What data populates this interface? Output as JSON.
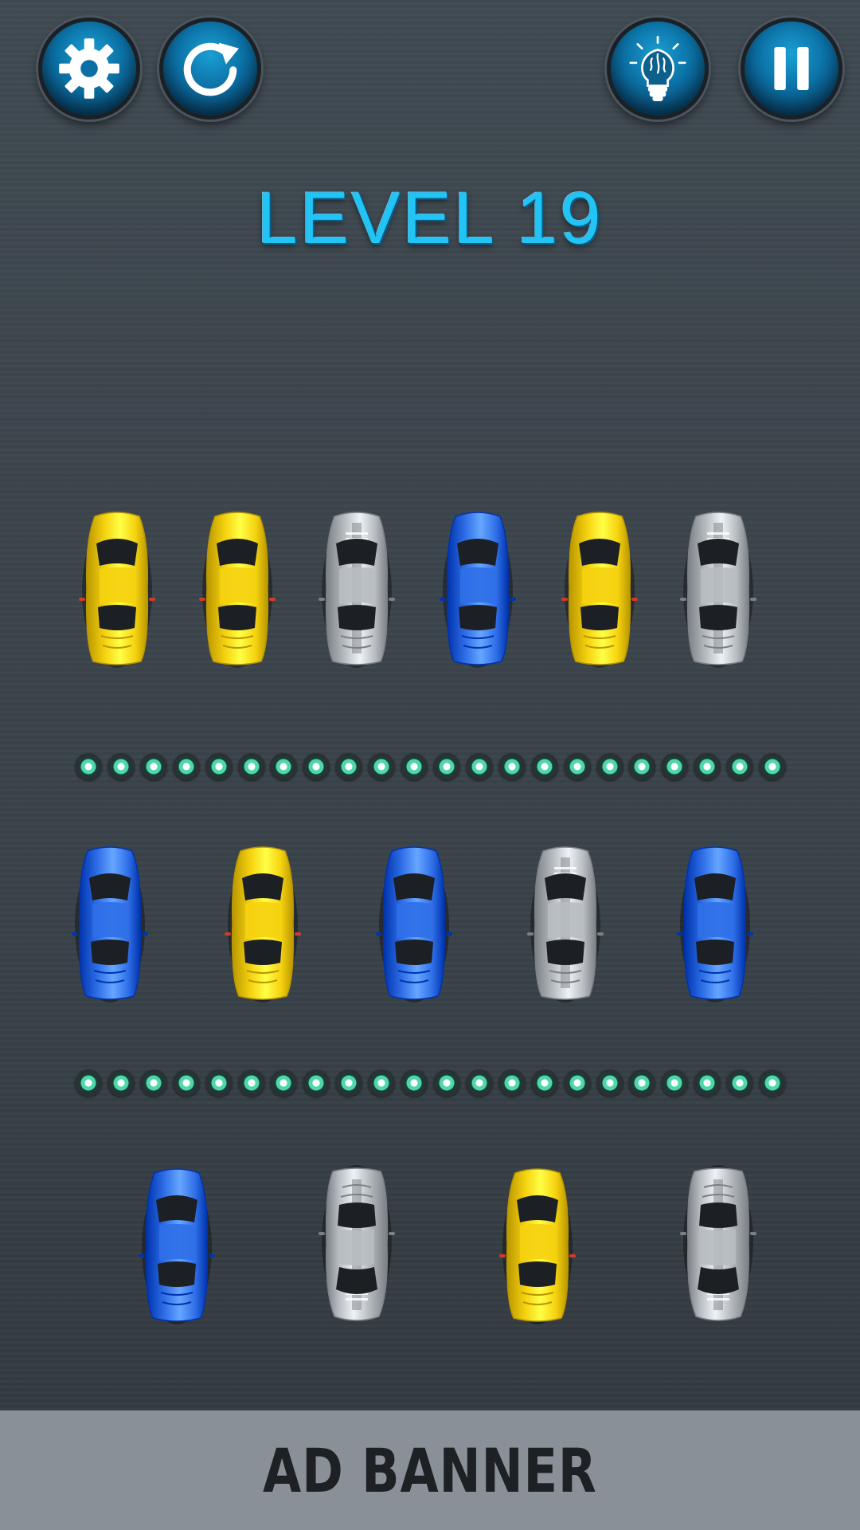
{
  "level": {
    "title": "LEVEL 19"
  },
  "buttons": [
    {
      "id": "settings",
      "icon": "gear-icon"
    },
    {
      "id": "restart",
      "icon": "restart-icon"
    },
    {
      "id": "hint",
      "icon": "lightbulb-brain-icon"
    },
    {
      "id": "pause",
      "icon": "pause-icon"
    }
  ],
  "colors": {
    "yellow": "#f5d20f",
    "blue": "#2f6fe8",
    "silver": "#b7bcc1",
    "accent": "#22c4f5",
    "button": "#0b6fa3"
  },
  "rows": [
    {
      "cars": [
        {
          "color": "yellow",
          "facing": "up"
        },
        {
          "color": "yellow",
          "facing": "up"
        },
        {
          "color": "silver",
          "facing": "up"
        },
        {
          "color": "blue",
          "facing": "up"
        },
        {
          "color": "yellow",
          "facing": "up"
        },
        {
          "color": "silver",
          "facing": "up"
        }
      ]
    },
    {
      "cars": [
        {
          "color": "blue",
          "facing": "up"
        },
        {
          "color": "yellow",
          "facing": "up"
        },
        {
          "color": "blue",
          "facing": "up"
        },
        {
          "color": "silver",
          "facing": "up"
        },
        {
          "color": "blue",
          "facing": "up"
        }
      ]
    },
    {
      "cars": [
        {
          "color": "blue",
          "facing": "up"
        },
        {
          "color": "silver",
          "facing": "down"
        },
        {
          "color": "yellow",
          "facing": "up"
        },
        {
          "color": "silver",
          "facing": "down"
        }
      ]
    }
  ],
  "dividers": [
    {
      "count": 22
    },
    {
      "count": 22
    }
  ],
  "ad": {
    "label": "AD BANNER"
  }
}
